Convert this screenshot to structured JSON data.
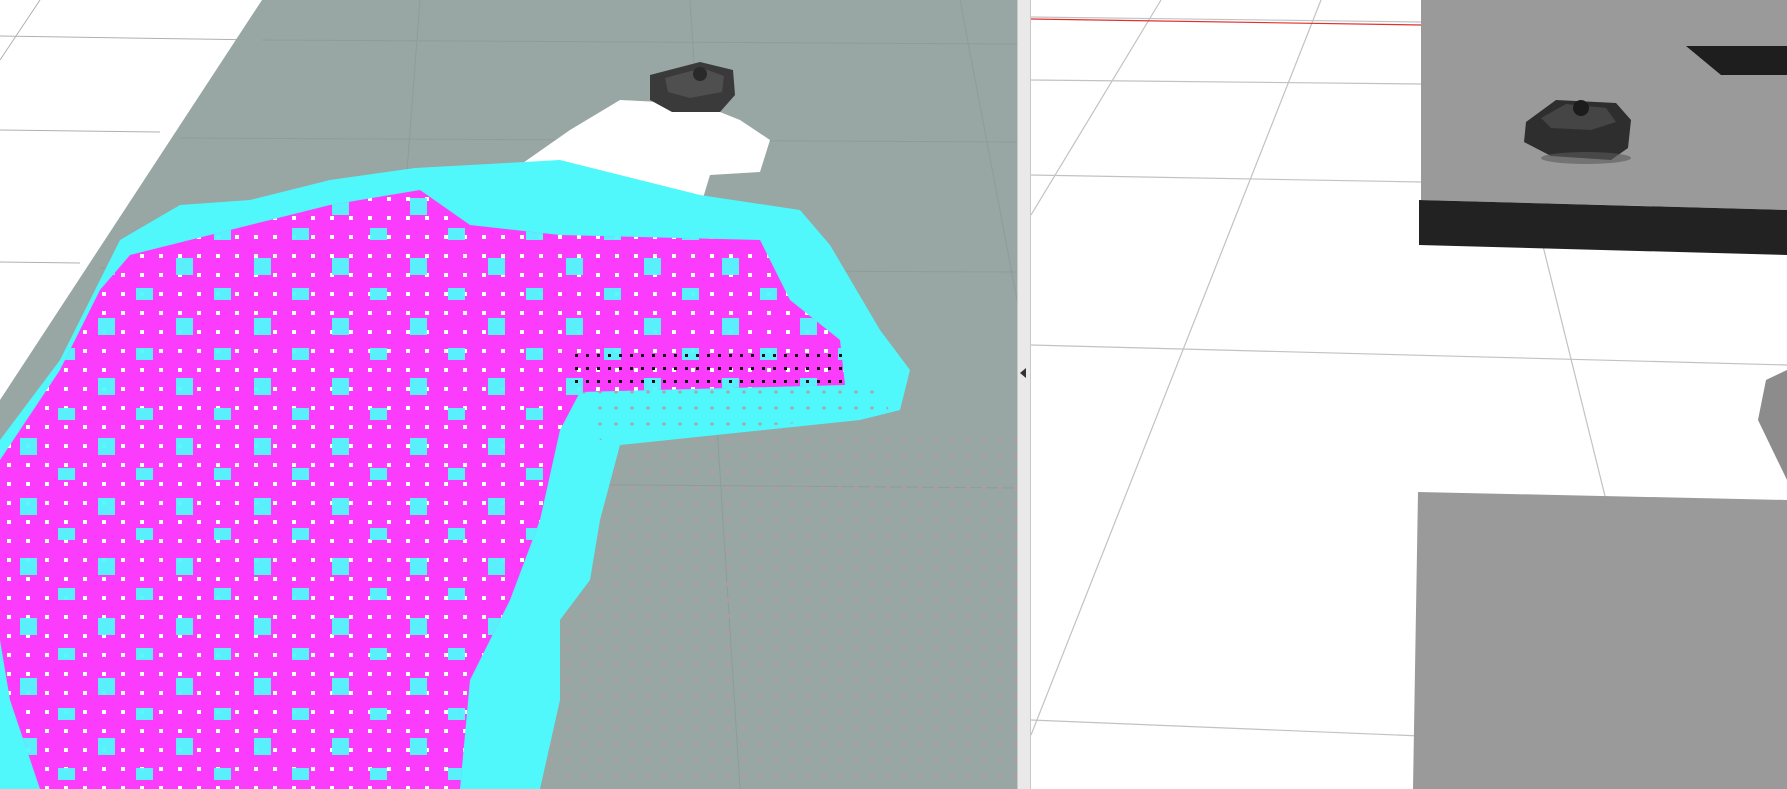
{
  "rviz_view": {
    "colors": {
      "background": "#ffffff",
      "grid_line": "#a8a8a8",
      "unknown_space": "#98a6a4",
      "free_space": "#ffffff",
      "inflation": "#50f8fc",
      "lethal": "#fc3cfc",
      "robot_body": "#3a3a3a",
      "laser_points": "#111111"
    },
    "icons": [
      "robot-model-icon"
    ]
  },
  "splitter": {
    "icons": [
      "collapse-arrow-icon"
    ]
  },
  "gazebo_view": {
    "colors": {
      "ground": "#ffffff",
      "grid_line": "#bdbdbd",
      "obstacle_top": "#9a9a9a",
      "obstacle_side": "#222222",
      "robot_body": "#2e2e2e",
      "axis_line": "#e03030"
    },
    "icons": [
      "robot-model-icon"
    ]
  }
}
